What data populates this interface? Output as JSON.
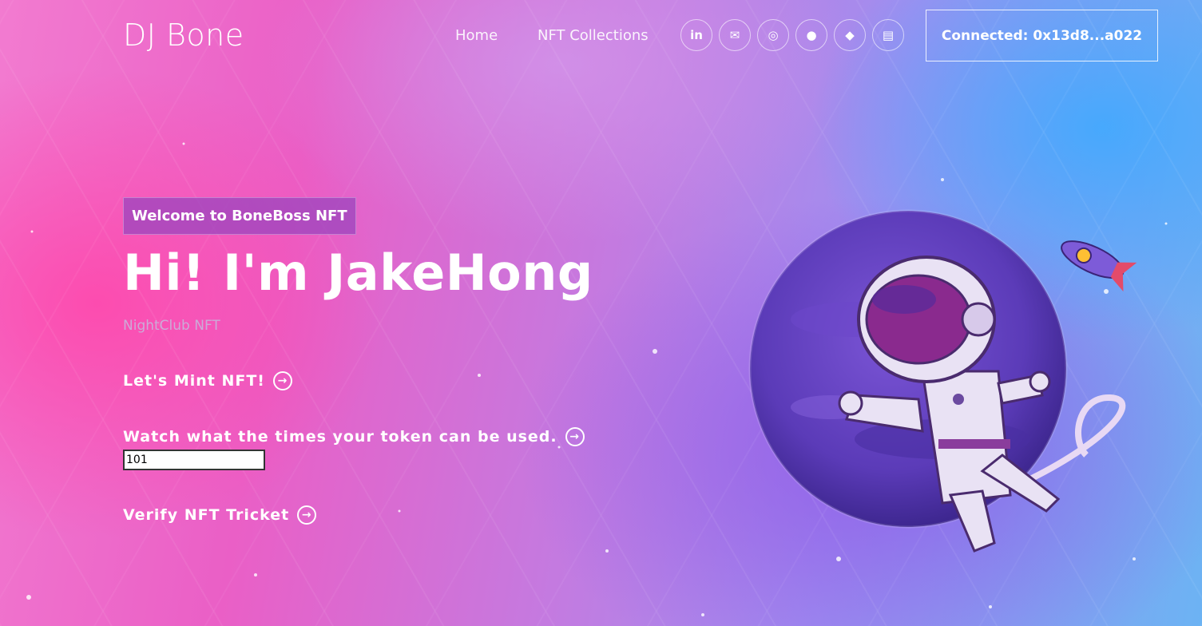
{
  "brand": "DJ Bone",
  "nav": {
    "home": "Home",
    "collections": "NFT Collections"
  },
  "social": [
    {
      "icon": "linkedin-icon",
      "glyph": "in"
    },
    {
      "icon": "mail-icon",
      "glyph": "✉"
    },
    {
      "icon": "instagram-icon",
      "glyph": "◎"
    },
    {
      "icon": "github-icon",
      "glyph": "●"
    },
    {
      "icon": "ethereum-icon",
      "glyph": "◆"
    },
    {
      "icon": "document-icon",
      "glyph": "▤"
    }
  ],
  "wallet": {
    "label": "Connected: 0x13d8...a022"
  },
  "hero": {
    "badge": "Welcome to BoneBoss NFT",
    "title": "Hi! I'm JakeHong",
    "subtitle": "NightClub NFT"
  },
  "actions": {
    "mint": "Let's Mint NFT!",
    "watch": "Watch what the times your token can be used.",
    "verify": "Verify NFT Tricket"
  },
  "token_input": {
    "value": "101"
  },
  "colors": {
    "pink": "#ea5fc6",
    "purple": "#7a55d8",
    "blue": "#5bb6f5"
  }
}
